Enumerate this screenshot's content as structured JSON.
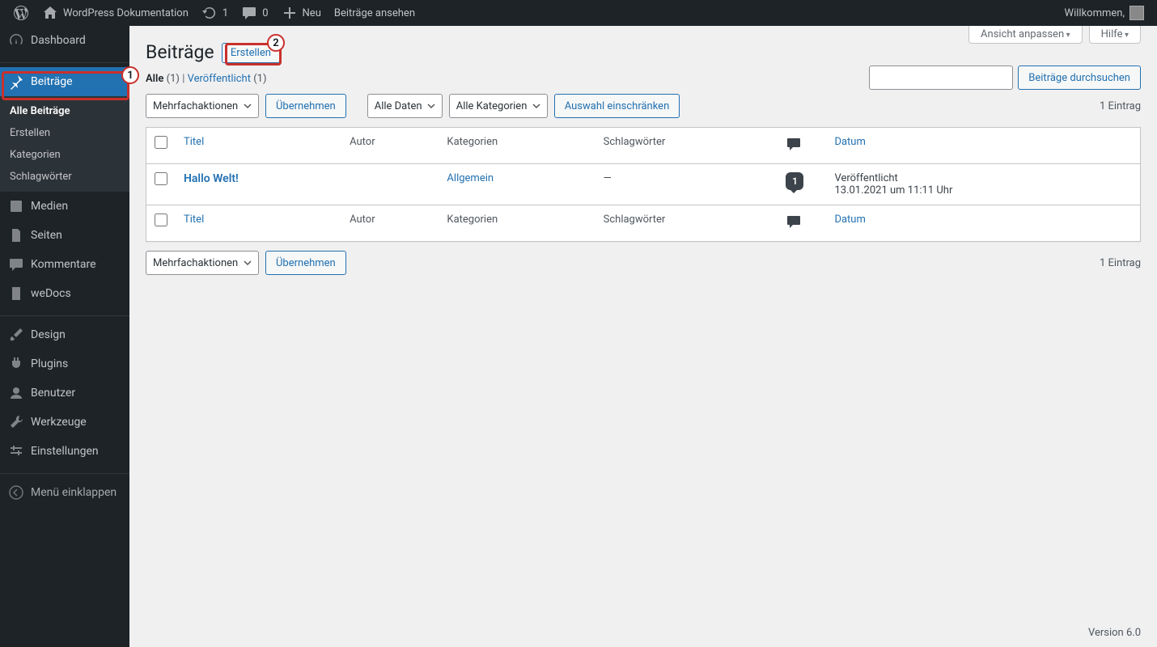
{
  "adminbar": {
    "site_name": "WordPress Dokumentation",
    "updates_count": "1",
    "comments_count": "0",
    "new_label": "Neu",
    "view_posts_label": "Beiträge ansehen",
    "welcome": "Willkommen,"
  },
  "menu": {
    "dashboard": "Dashboard",
    "posts": "Beiträge",
    "posts_sub": {
      "all": "Alle Beiträge",
      "create": "Erstellen",
      "categories": "Kategorien",
      "tags": "Schlagwörter"
    },
    "media": "Medien",
    "pages": "Seiten",
    "comments": "Kommentare",
    "wedocs": "weDocs",
    "design": "Design",
    "plugins": "Plugins",
    "users": "Benutzer",
    "tools": "Werkzeuge",
    "settings": "Einstellungen",
    "collapse": "Menü einklappen"
  },
  "screen_options": "Ansicht anpassen",
  "help": "Hilfe",
  "page": {
    "title": "Beiträge",
    "create_btn": "Erstellen"
  },
  "views": {
    "all_label": "Alle",
    "all_count": "(1)",
    "sep": "  |  ",
    "published_label": "Veröffentlicht",
    "published_count": "(1)"
  },
  "search": {
    "button": "Beiträge durchsuchen"
  },
  "bulk": {
    "label": "Mehrfachaktionen",
    "apply": "Übernehmen"
  },
  "filter": {
    "dates": "Alle Daten",
    "cats": "Alle Kategorien",
    "apply": "Auswahl einschränken"
  },
  "count_label": "1 Eintrag",
  "columns": {
    "title": "Titel",
    "author": "Autor",
    "categories": "Kategorien",
    "tags": "Schlagwörter",
    "date": "Datum"
  },
  "row": {
    "title": "Hallo Welt!",
    "category": "Allgemein",
    "tags": "—",
    "comments": "1",
    "date_status": "Veröffentlicht",
    "date_value": "13.01.2021 um 11:11 Uhr"
  },
  "footer": "Version 6.0",
  "annotations": {
    "n1": "1",
    "n2": "2"
  }
}
